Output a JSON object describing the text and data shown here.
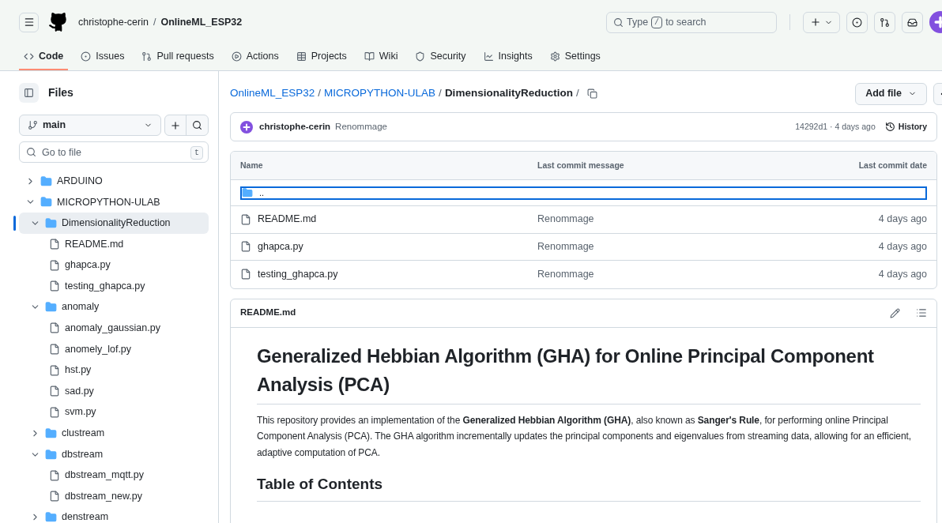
{
  "header": {
    "owner": "christophe-cerin",
    "separator": "/",
    "repo": "OnlineML_ESP32",
    "search": {
      "prefix": "Type",
      "key": "/",
      "suffix": "to search"
    }
  },
  "nav_tabs": [
    {
      "label": "Code",
      "selected": true
    },
    {
      "label": "Issues",
      "selected": false
    },
    {
      "label": "Pull requests",
      "selected": false
    },
    {
      "label": "Actions",
      "selected": false
    },
    {
      "label": "Projects",
      "selected": false
    },
    {
      "label": "Wiki",
      "selected": false
    },
    {
      "label": "Security",
      "selected": false
    },
    {
      "label": "Insights",
      "selected": false
    },
    {
      "label": "Settings",
      "selected": false
    }
  ],
  "sidebar": {
    "title": "Files",
    "branch": "main",
    "go_to_file": {
      "placeholder": "Go to file",
      "shortcut": "t"
    },
    "tree": [
      {
        "name": "ARDUINO",
        "kind": "folder",
        "expanded": false,
        "selected": false
      },
      {
        "name": "MICROPYTHON-ULAB",
        "kind": "folder",
        "expanded": true,
        "selected": false,
        "children": [
          {
            "name": "DimensionalityReduction",
            "kind": "folder",
            "expanded": true,
            "selected": true,
            "children": [
              {
                "name": "README.md",
                "kind": "file",
                "selected": false
              },
              {
                "name": "ghapca.py",
                "kind": "file",
                "selected": false
              },
              {
                "name": "testing_ghapca.py",
                "kind": "file",
                "selected": false
              }
            ]
          },
          {
            "name": "anomaly",
            "kind": "folder",
            "expanded": true,
            "selected": false,
            "children": [
              {
                "name": "anomaly_gaussian.py",
                "kind": "file",
                "selected": false
              },
              {
                "name": "anomely_lof.py",
                "kind": "file",
                "selected": false
              },
              {
                "name": "hst.py",
                "kind": "file",
                "selected": false
              },
              {
                "name": "sad.py",
                "kind": "file",
                "selected": false
              },
              {
                "name": "svm.py",
                "kind": "file",
                "selected": false
              }
            ]
          },
          {
            "name": "clustream",
            "kind": "folder",
            "expanded": false,
            "selected": false
          },
          {
            "name": "dbstream",
            "kind": "folder",
            "expanded": true,
            "selected": false,
            "children": [
              {
                "name": "dbstream_mqtt.py",
                "kind": "file",
                "selected": false
              },
              {
                "name": "dbstream_new.py",
                "kind": "file",
                "selected": false
              }
            ]
          },
          {
            "name": "denstream",
            "kind": "folder",
            "expanded": false,
            "selected": false
          }
        ]
      }
    ]
  },
  "breadcrumb": [
    {
      "label": "OnlineML_ESP32",
      "kind": "link"
    },
    {
      "label": "/",
      "kind": "sep"
    },
    {
      "label": "MICROPYTHON-ULAB",
      "kind": "link"
    },
    {
      "label": "/",
      "kind": "sep"
    },
    {
      "label": "DimensionalityReduction",
      "kind": "current"
    },
    {
      "label": "/",
      "kind": "sep"
    }
  ],
  "add_file": "Add file",
  "commit": {
    "author": "christophe-cerin",
    "message": "Renommage",
    "sha_time": "14292d1 · 4 days ago",
    "history": "History"
  },
  "table": {
    "columns": [
      "Name",
      "Last commit message",
      "Last commit date"
    ],
    "parent_row": {
      "label": "..",
      "focused": true
    },
    "rows": [
      {
        "name": "README.md",
        "message": "Renommage",
        "date": "4 days ago"
      },
      {
        "name": "ghapca.py",
        "message": "Renommage",
        "date": "4 days ago"
      },
      {
        "name": "testing_ghapca.py",
        "message": "Renommage",
        "date": "4 days ago"
      }
    ]
  },
  "readme": {
    "filename": "README.md",
    "title": "Generalized Hebbian Algorithm (GHA) for Online Principal Component Analysis (PCA)",
    "paragraph": "This repository provides an implementation of the **Generalized Hebbian Algorithm (GHA)**, also known as **Sanger's Rule**, for performing online Principal Component Analysis (PCA). The GHA algorithm incrementally updates the principal components and eigenvalues from streaming data, allowing for an efficient, adaptive computation of PCA.",
    "heading": "Table of Contents"
  }
}
